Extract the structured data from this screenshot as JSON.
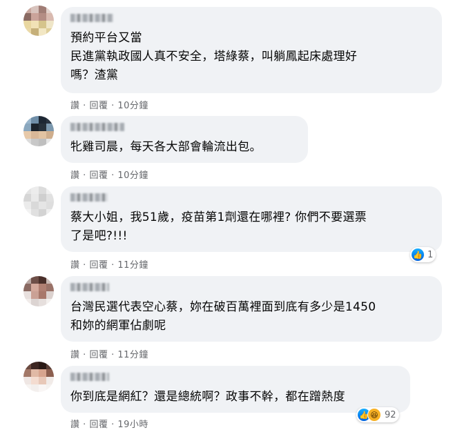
{
  "comments": [
    {
      "text": "預約平台又當\n民進黨執政國人真不安全，塔綠蔡，叫躺鳳起床處理好\n嗎？渣黨",
      "actions": {
        "like": "讚",
        "sep1": "·",
        "reply": "回覆",
        "sep2": "·",
        "time": "10分鐘"
      },
      "avatar_colors": [
        "#c9a9a0",
        "#d8c3bd",
        "#a07d75",
        "#e3d2cc",
        "#8a6a62",
        "#caa39a",
        "#b48d84",
        "#d9bab0",
        "#e9d7a0",
        "#f1e2b6",
        "#d5c48c",
        "#efe6c8",
        "#ead9a8",
        "#c6b07a",
        "#f2e7c4",
        "#dfcf9b"
      ]
    },
    {
      "text": "牝雞司晨，每天各大部會輪流出包。",
      "actions": {
        "like": "讚",
        "sep1": "·",
        "reply": "回覆",
        "sep2": "·",
        "time": "10分鐘"
      },
      "avatar_colors": [
        "#9ab6cc",
        "#6f8ea8",
        "#1d2733",
        "#2a3440",
        "#8aa7be",
        "#1b232c",
        "#27313b",
        "#7c98ae",
        "#e7c9a9",
        "#d9b898",
        "#e2c3a2",
        "#cfae8d",
        "#dcdcdc",
        "#c8c8c8",
        "#bfbfbf",
        "#e6e6e6"
      ]
    },
    {
      "text": "蔡大小姐，我51歲，疫苗第1劑還在哪裡? 你們不要選票\n了是吧?!!!",
      "actions": {
        "like": "讚",
        "sep1": "·",
        "reply": "回覆",
        "sep2": "·",
        "time": "11分鐘"
      },
      "reaction": {
        "count": "1",
        "icons": [
          "like-icon"
        ]
      },
      "avatar_colors": [
        "#e4e4e4",
        "#ececec",
        "#dcdcdc",
        "#f0f0f0",
        "#d6d6d6",
        "#e9e9e9",
        "#cfcfcf",
        "#e1e1e1",
        "#ebebeb",
        "#d9d9d9",
        "#e5e5e5",
        "#dedede",
        "#f2f2f2",
        "#e0e0e0",
        "#d3d3d3",
        "#eeeeee"
      ]
    },
    {
      "text": "台灣民選代表空心蔡，妳在破百萬裡面到底有多少是1450\n和妳的網軍佔劇呢",
      "actions": {
        "like": "讚",
        "sep1": "·",
        "reply": "回覆",
        "sep2": "·",
        "time": "11分鐘"
      },
      "avatar_colors": [
        "#b8a8a4",
        "#6e4f48",
        "#4a2f2a",
        "#c9b9b4",
        "#8a6a62",
        "#d4a99c",
        "#b07f72",
        "#9a7268",
        "#e8e0de",
        "#caa195",
        "#a8786b",
        "#dcd2cf",
        "#f1ecea",
        "#dcd4d2",
        "#e6dfdd",
        "#f4f0ee"
      ]
    },
    {
      "text": "你到底是網紅？還是總統啊？政事不幹，都在蹭熱度",
      "actions": {
        "like": "讚",
        "sep1": "·",
        "reply": "回覆",
        "sep2": "·",
        "time": "19小時"
      },
      "reaction": {
        "count": "92",
        "icons": [
          "like-icon",
          "haha-icon"
        ]
      },
      "avatar_colors": [
        "#6b4a40",
        "#3c2621",
        "#2a1a16",
        "#5a3e36",
        "#a37868",
        "#e0b9a5",
        "#d7a58f",
        "#8c5f4f",
        "#efe7e4",
        "#f4dcd0",
        "#e8c8b8",
        "#f1ebe8",
        "#f7f3f1",
        "#f3efed",
        "#f9f6f5",
        "#f5f2f0"
      ]
    }
  ]
}
